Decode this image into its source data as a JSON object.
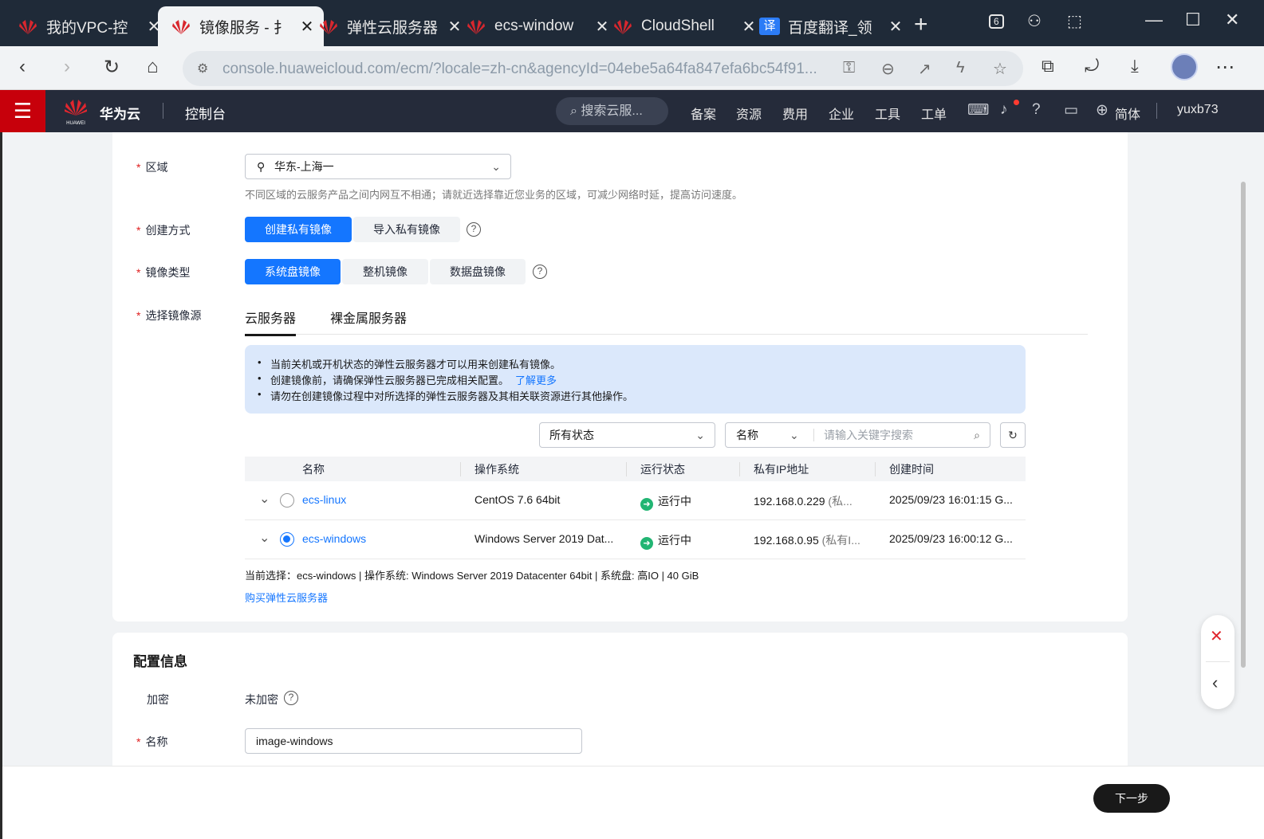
{
  "browser": {
    "tabs": [
      {
        "title": "我的VPC-控",
        "icon": "huawei-logo"
      },
      {
        "title": "镜像服务 - 扌",
        "icon": "huawei-logo",
        "active": true
      },
      {
        "title": "弹性云服务器",
        "icon": "huawei-logo"
      },
      {
        "title": "ecs-window",
        "icon": "huawei-logo"
      },
      {
        "title": "CloudShell",
        "icon": "huawei-logo"
      },
      {
        "title": "百度翻译_领",
        "icon": "translate-logo"
      }
    ],
    "tab_icon_text": "译",
    "tab_count_badge": "6",
    "url": "console.huaweicloud.com/ecm/?locale=zh-cn&agencyId=04ebe5a64fa847efa6bc54f91..."
  },
  "header": {
    "brand": "华为云",
    "logo_text": "HUAWEI",
    "console": "控制台",
    "search_placeholder": "搜索云服...",
    "nav": [
      "备案",
      "资源",
      "费用",
      "企业",
      "工具",
      "工单"
    ],
    "language": "简体",
    "user": "yuxb73"
  },
  "form": {
    "region": {
      "label": "区域",
      "value": "华东-上海一",
      "hint": "不同区域的云服务产品之间内网互不相通；请就近选择靠近您业务的区域，可减少网络时延，提高访问速度。"
    },
    "create_method": {
      "label": "创建方式",
      "options": [
        "创建私有镜像",
        "导入私有镜像"
      ]
    },
    "image_type": {
      "label": "镜像类型",
      "options": [
        "系统盘镜像",
        "整机镜像",
        "数据盘镜像"
      ]
    },
    "source": {
      "label": "选择镜像源",
      "tabs": [
        "云服务器",
        "裸金属服务器"
      ],
      "notice": [
        "当前关机或开机状态的弹性云服务器才可以用来创建私有镜像。",
        "创建镜像前，请确保弹性云服务器已完成相关配置。",
        "请勿在创建镜像过程中对所选择的弹性云服务器及其相关联资源进行其他操作。"
      ],
      "learn_more": "了解更多",
      "status_filter": "所有状态",
      "search_field": "名称",
      "search_placeholder": "请输入关键字搜索",
      "columns": [
        "名称",
        "操作系统",
        "运行状态",
        "私有IP地址",
        "创建时间"
      ],
      "rows": [
        {
          "name": "ecs-linux",
          "os": "CentOS 7.6 64bit",
          "status": "运行中",
          "ip": "192.168.0.229",
          "ip_note": "(私...",
          "created": "2025/09/23 16:01:15 G..."
        },
        {
          "name": "ecs-windows",
          "os": "Windows Server 2019 Dat...",
          "status": "运行中",
          "ip": "192.168.0.95",
          "ip_note": "(私有I...",
          "created": "2025/09/23 16:00:12 G..."
        }
      ],
      "selection_summary": "当前选择：ecs-windows | 操作系统: Windows Server 2019 Datacenter 64bit | 系统盘: 高IO | 40 GiB",
      "buy_link": "购买弹性云服务器"
    },
    "config": {
      "title": "配置信息",
      "encrypt_label": "加密",
      "encrypt_value": "未加密",
      "name_label": "名称",
      "name_value": "image-windows"
    }
  },
  "footer": {
    "next": "下一步"
  },
  "colors": {
    "primary": "#1476ff",
    "header_bg": "#252b3a",
    "huawei_red": "#c7000b",
    "running": "#22b573"
  }
}
